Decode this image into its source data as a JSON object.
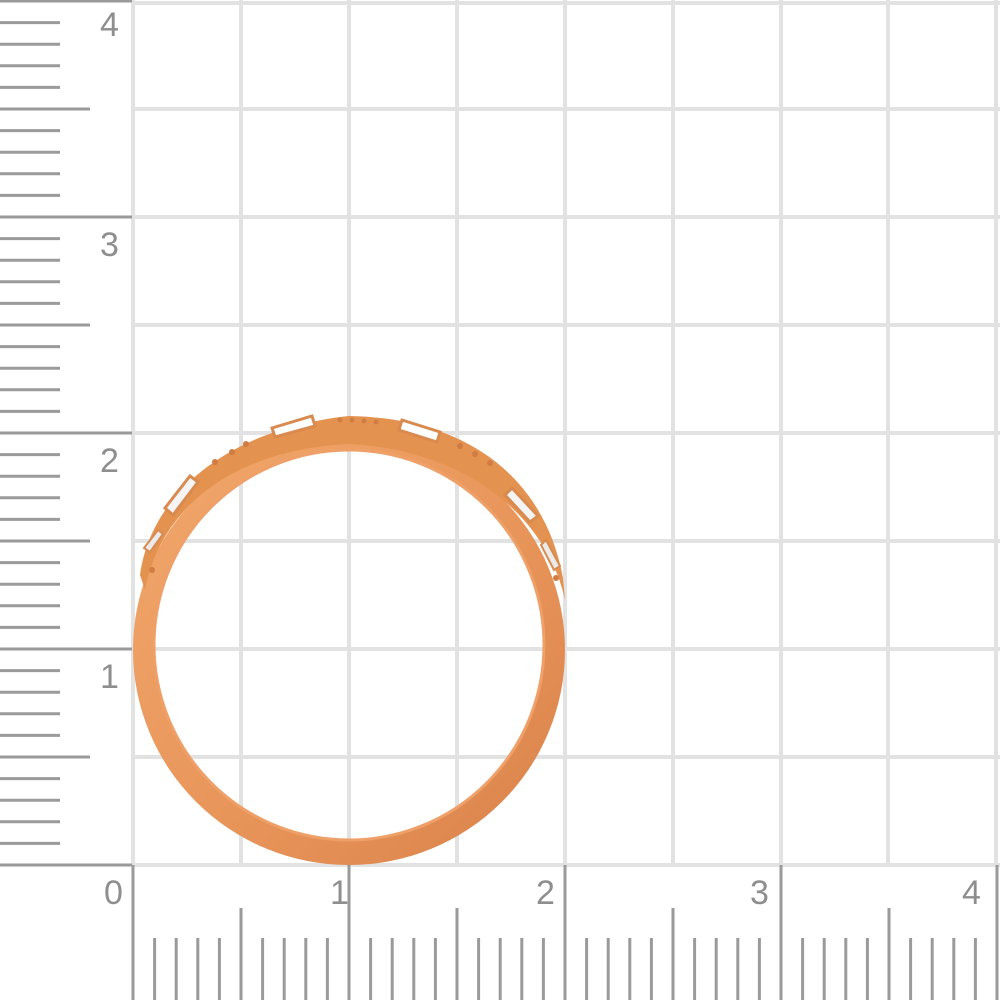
{
  "ruler": {
    "x_labels": [
      "0",
      "1",
      "2",
      "3",
      "4"
    ],
    "y_labels": [
      "1",
      "2",
      "3",
      "4"
    ],
    "grid_color": "#e2e2e2",
    "ruler_color": "#9a9a9a",
    "label_color": "#8e8e8e"
  },
  "ring": {
    "metal_color": "#e8955a",
    "stone_color": "#ffffff",
    "stones_visible": 6
  }
}
